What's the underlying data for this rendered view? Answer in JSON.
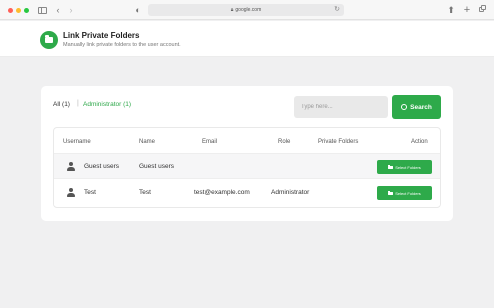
{
  "browser": {
    "url": "google.com"
  },
  "header": {
    "title": "Link Private Folders",
    "subtitle": "Manually link private folders to the user account."
  },
  "filters": {
    "all_label": "All (1)",
    "separator": "|",
    "admin_label": "Administrator (1)"
  },
  "search": {
    "placeholder": "Type here...",
    "button_label": "Search"
  },
  "table": {
    "columns": [
      "Username",
      "Name",
      "Email",
      "Role",
      "Private Folders",
      "Action"
    ],
    "rows": [
      {
        "username": "Guest users",
        "name": "Guest users",
        "email": "",
        "role": "",
        "private_folders": "",
        "action": "Select Folders"
      },
      {
        "username": "Test",
        "name": "Test",
        "email": "test@example.com",
        "role": "Administrator",
        "private_folders": "",
        "action": "Select Folders"
      }
    ]
  },
  "colors": {
    "accent": "#2eaa4a",
    "background": "#f0f0f1"
  },
  "icons": {
    "app_logo": "folder-icon",
    "search": "search-icon",
    "avatar": "user-icon",
    "action": "folder-icon"
  }
}
